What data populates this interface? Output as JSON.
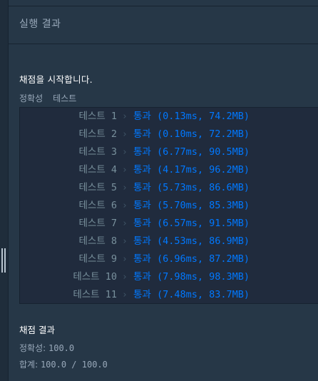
{
  "header": {
    "title": "실행 결과"
  },
  "intro_text": "채점을 시작합니다.",
  "tabs": [
    "정확성",
    "테스트"
  ],
  "tests": [
    {
      "label": "테스트 1",
      "status": "통과",
      "detail": "(0.13ms, 74.2MB)"
    },
    {
      "label": "테스트 2",
      "status": "통과",
      "detail": "(0.10ms, 72.2MB)"
    },
    {
      "label": "테스트 3",
      "status": "통과",
      "detail": "(6.77ms, 90.5MB)"
    },
    {
      "label": "테스트 4",
      "status": "통과",
      "detail": "(4.17ms, 96.2MB)"
    },
    {
      "label": "테스트 5",
      "status": "통과",
      "detail": "(5.73ms, 86.6MB)"
    },
    {
      "label": "테스트 6",
      "status": "통과",
      "detail": "(5.70ms, 85.3MB)"
    },
    {
      "label": "테스트 7",
      "status": "통과",
      "detail": "(6.57ms, 91.5MB)"
    },
    {
      "label": "테스트 8",
      "status": "통과",
      "detail": "(4.53ms, 86.9MB)"
    },
    {
      "label": "테스트 9",
      "status": "통과",
      "detail": "(6.96ms, 87.2MB)"
    },
    {
      "label": "테스트 10",
      "status": "통과",
      "detail": "(7.98ms, 98.3MB)"
    },
    {
      "label": "테스트 11",
      "status": "통과",
      "detail": "(7.48ms, 83.7MB)"
    }
  ],
  "summary": {
    "title": "채점 결과",
    "accuracy_label": "정확성:",
    "accuracy_value": "100.0",
    "total_label": "합계:",
    "total_value": "100.0 / 100.0"
  },
  "colors": {
    "background": "#263747",
    "panel": "#202b3d",
    "pass": "#0078ff",
    "muted": "#98a8b9"
  }
}
